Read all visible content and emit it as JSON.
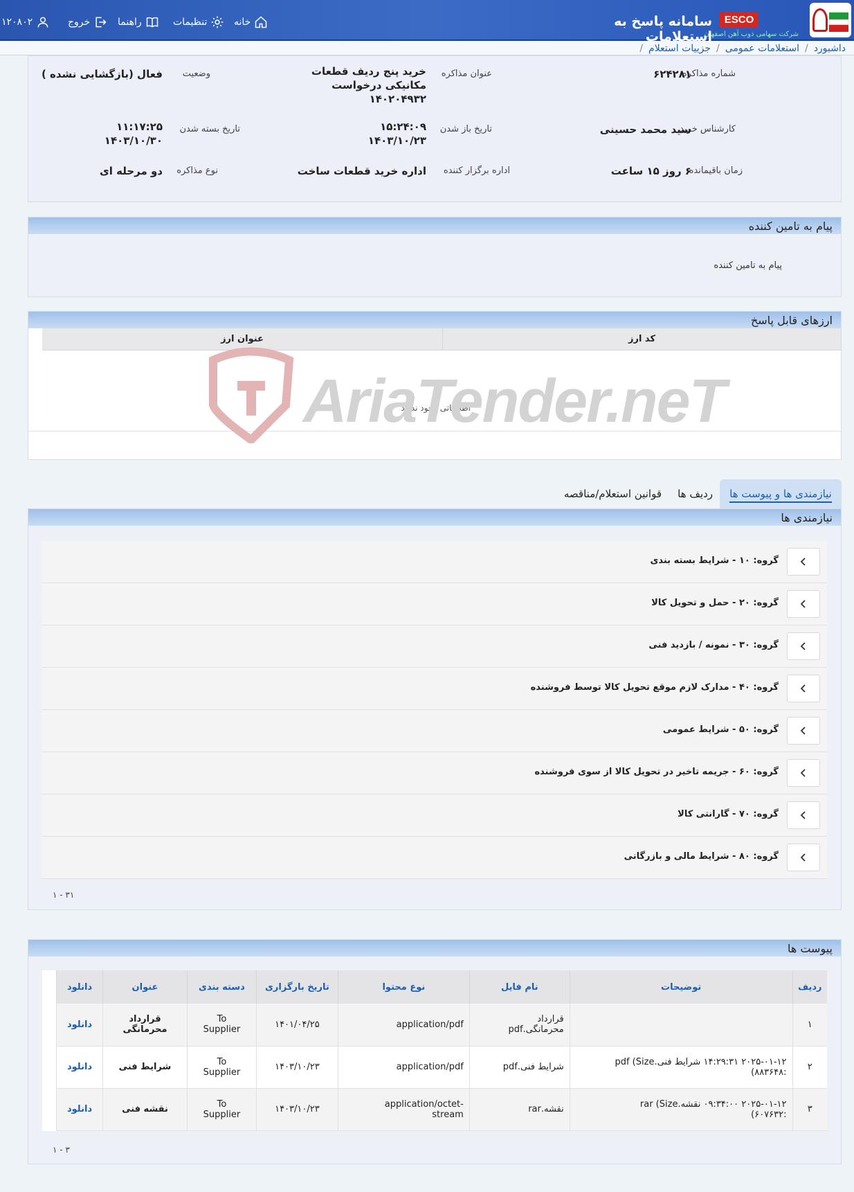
{
  "header": {
    "app_title": "سامانه پاسخ به استعلامات",
    "esco": "ESCO",
    "company_sub": "شرکت سهامی ذوب آهن اصفهان",
    "nav": {
      "home": "خانه",
      "settings": "تنظیمات",
      "guide": "راهنما",
      "logout": "خروج",
      "user_id": "۱۲۰۸۰۲"
    }
  },
  "breadcrumb": [
    "داشبورد",
    "استعلامات عمومی",
    "جزییات استعلام"
  ],
  "info": {
    "negotiation_no_label": "شماره مذاکره",
    "negotiation_no": "۶۲۴۲۸۱",
    "title_label": "عنوان مذاکره",
    "title_line1": "خرید پنج ردیف قطعات",
    "title_line2": "مکانیکی درخواست",
    "title_line3": "۱۴۰۲۰۴۹۳۲",
    "status_label": "وضعیت",
    "status": "فعال (بازگشایی نشده )",
    "expert_label": "کارشناس خرید",
    "expert": "سید محمد حسینی",
    "open_date_label": "تاریخ باز شدن",
    "open_time": "۱۵:۲۴:۰۹",
    "open_date": "۱۴۰۳/۱۰/۲۳",
    "close_date_label": "تاریخ بسته شدن",
    "close_time": "۱۱:۱۷:۲۵",
    "close_date": "۱۴۰۳/۱۰/۳۰",
    "remaining_label": "زمان باقیمانده",
    "remaining": "۶ روز ۱۵ ساعت",
    "organizer_label": "اداره برگزار کننده",
    "organizer": "اداره خرید قطعات ساخت",
    "type_label": "نوع مذاکره",
    "type": "دو مرحله ای"
  },
  "supplier_message": {
    "heading": "پیام به تامین کننده",
    "body": "پیام به تامین کننده"
  },
  "currencies": {
    "heading": "ارزهای قابل پاسخ",
    "col_code": "کد ارز",
    "col_title": "عنوان ارز",
    "empty": "اطلاعاتی وجود ندارد"
  },
  "watermark": "AriaTender.neT",
  "tabs": [
    "نیازمندی ها و پیوست ها",
    "ردیف ها",
    "قوانین استعلام/مناقصه"
  ],
  "requirements": {
    "heading": "نیازمندی ها",
    "groups": [
      "گروه: ۱۰ - شرایط بسته بندی",
      "گروه: ۲۰ - حمل و تحویل کالا",
      "گروه: ۳۰ - نمونه / بازدید فنی",
      "گروه: ۴۰ - مدارک لازم موقع تحویل کالا توسط فروشنده",
      "گروه: ۵۰ - شرایط عمومی",
      "گروه: ۶۰ - جریمه تاخیر در تحویل کالا از سوی فروشنده",
      "گروه: ۷۰ - گارانتی کالا",
      "گروه: ۸۰ - شرایط مالی و بازرگانی"
    ],
    "pager": "۱ - ۳۱"
  },
  "attachments": {
    "heading": "پیوست ها",
    "columns": [
      "ردیف",
      "توضیحات",
      "نام فایل",
      "نوع محتوا",
      "تاریخ بارگزاری",
      "دسته بندی",
      "عنوان",
      "دانلود"
    ],
    "rows": [
      {
        "row": "۱",
        "desc1": "",
        "desc2": "",
        "file1": "قرارداد",
        "file2": "محرمانگی.pdf",
        "type1": "application/pdf",
        "type2": "",
        "date": "۱۴۰۱/۰۴/۲۵",
        "cat1": "To",
        "cat2": "Supplier",
        "title1": "قرارداد",
        "title2": "محرمانگی",
        "download": "دانلود"
      },
      {
        "row": "۲",
        "desc1": "۲۰۲۵-۰۱-۱۲ ۱۴:۲۹:۳۱ شرایط فنی.pdf (Size",
        "desc2": ":۸۸۳۶۴۸)",
        "file1": "شرایط فنی.pdf",
        "file2": "",
        "type1": "application/pdf",
        "type2": "",
        "date": "۱۴۰۳/۱۰/۲۳",
        "cat1": "To",
        "cat2": "Supplier",
        "title1": "شرایط فنی",
        "title2": "",
        "download": "دانلود"
      },
      {
        "row": "۳",
        "desc1": "۲۰۲۵-۰۱-۱۲ ۰۹:۳۴:۰۰ نقشه.rar (Size",
        "desc2": ":۶۰۷۶۳۲)",
        "file1": "نقشه.rar",
        "file2": "",
        "type1": "application/octet-",
        "type2": "stream",
        "date": "۱۴۰۳/۱۰/۲۳",
        "cat1": "To",
        "cat2": "Supplier",
        "title1": "نقشه فنی",
        "title2": "",
        "download": "دانلود"
      }
    ],
    "pager": "۱ - ۳"
  }
}
